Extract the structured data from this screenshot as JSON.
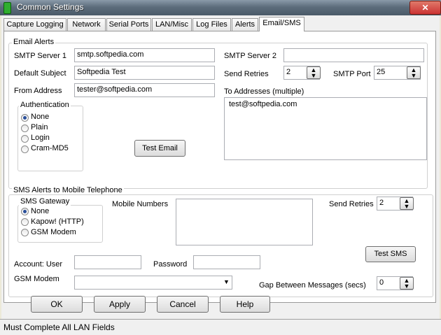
{
  "window": {
    "title": "Common Settings",
    "close_glyph": "✕",
    "app_icon": "app-icon"
  },
  "tabs": [
    {
      "label": "Capture Logging"
    },
    {
      "label": "Network"
    },
    {
      "label": "Serial Ports"
    },
    {
      "label": "LAN/Misc"
    },
    {
      "label": "Log Files"
    },
    {
      "label": "Alerts"
    },
    {
      "label": "Email/SMS",
      "active": true
    }
  ],
  "email": {
    "group_title": "Email Alerts",
    "smtp_server1_label": "SMTP Server 1",
    "smtp_server1_value": "smtp.softpedia.com",
    "smtp_server2_label": "SMTP Server 2",
    "smtp_server2_value": "",
    "default_subject_label": "Default Subject",
    "default_subject_value": "Softpedia Test",
    "send_retries_label": "Send Retries",
    "send_retries_value": "2",
    "smtp_port_label": "SMTP Port",
    "smtp_port_value": "25",
    "from_address_label": "From Address",
    "from_address_value": "tester@softpedia.com",
    "to_addresses_label": "To Addresses (multiple)",
    "to_addresses_value": "test@softpedia.com",
    "auth_title": "Authentication",
    "auth_options": [
      "None",
      "Plain",
      "Login",
      "Cram-MD5"
    ],
    "auth_selected": "None",
    "test_button": "Test Email"
  },
  "sms": {
    "group_title": "SMS Alerts to Mobile Telephone",
    "gateway_title": "SMS Gateway",
    "gateway_options": [
      "None",
      "Kapow! (HTTP)",
      "GSM Modem"
    ],
    "gateway_selected": "None",
    "mobile_numbers_label": "Mobile Numbers",
    "mobile_numbers_value": "",
    "send_retries_label": "Send Retries",
    "send_retries_value": "2",
    "test_button": "Test SMS",
    "account_user_label": "Account: User",
    "account_user_value": "",
    "password_label": "Password",
    "password_value": "",
    "gsm_modem_label": "GSM Modem",
    "gsm_modem_value": "",
    "gap_label": "Gap Between Messages (secs)",
    "gap_value": "0"
  },
  "buttons": {
    "ok": "OK",
    "apply": "Apply",
    "cancel": "Cancel",
    "help": "Help"
  },
  "status": {
    "text": "Must Complete All LAN Fields"
  },
  "icons": {
    "spin": "spin-updown-icon",
    "dropdown": "chevron-down-icon"
  }
}
